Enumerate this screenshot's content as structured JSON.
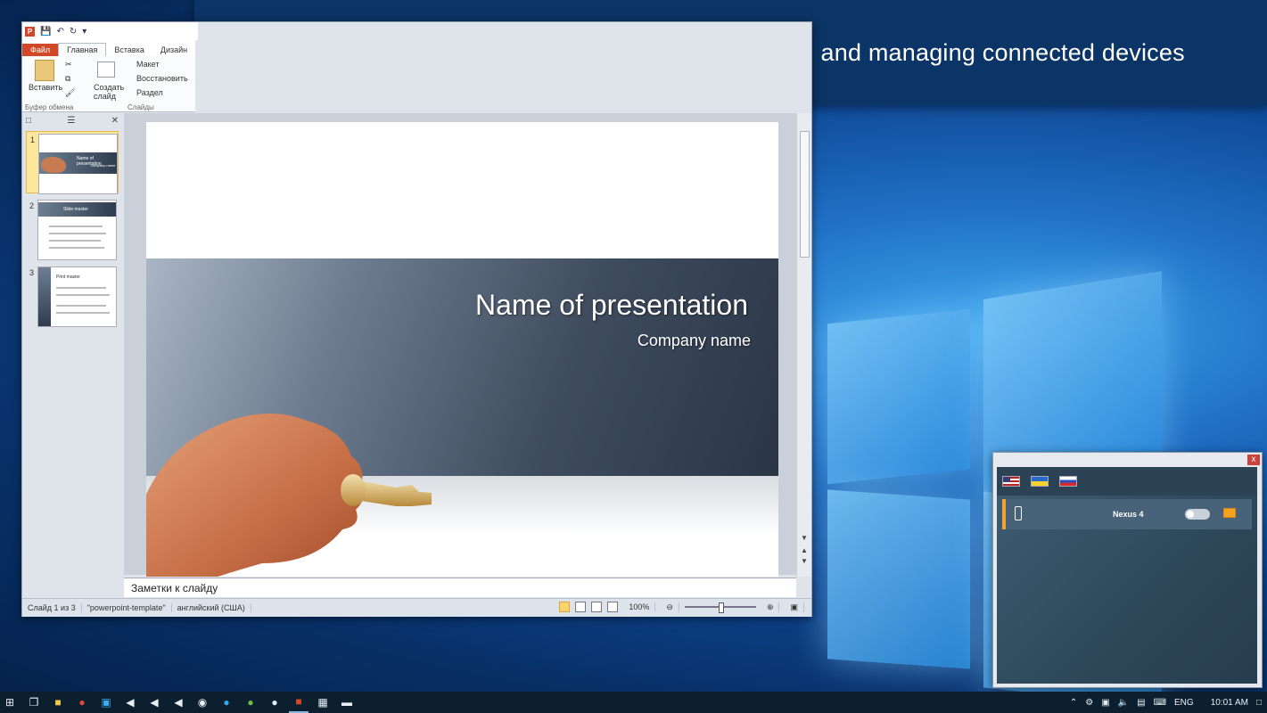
{
  "banner": {
    "text": "PC application provides easy presentation control and managing connected devices"
  },
  "powerpoint": {
    "app_icon": "P",
    "tabs": [
      "Файл",
      "Главная",
      "Вставка",
      "Дизайн"
    ],
    "ribbon": {
      "paste_label": "Вставить",
      "clipboard_group": "Буфер обмена",
      "new_slide_label": "Создать слайд",
      "layout_label": "Макет",
      "reset_label": "Восстановить",
      "section_label": "Раздел",
      "slides_group": "Слайды"
    },
    "thumbnails": [
      {
        "num": "1",
        "title": "Name of presentation",
        "subtitle": "company name",
        "selected": true
      },
      {
        "num": "2",
        "title": "Slide master",
        "selected": false
      },
      {
        "num": "3",
        "title": "Print master",
        "selected": false
      }
    ],
    "slide": {
      "title": "Name of presentation",
      "subtitle": "Company name"
    },
    "notes_placeholder": "Заметки к слайду",
    "status": {
      "slide_counter": "Слайд 1 из 3",
      "theme": "\"powerpoint-template\"",
      "language": "английский (США)",
      "zoom": "100%"
    }
  },
  "app": {
    "close_glyph": "x",
    "flags": [
      "us",
      "ua",
      "ru"
    ],
    "device": {
      "name": "Nexus 4",
      "connected": false
    }
  },
  "taskbar": {
    "tray": {
      "language": "ENG",
      "time": "10:01 AM"
    }
  },
  "colors": {
    "banner_bg": "#0b3566",
    "ppt_accent": "#d24726",
    "app_accent": "#f0a531"
  }
}
